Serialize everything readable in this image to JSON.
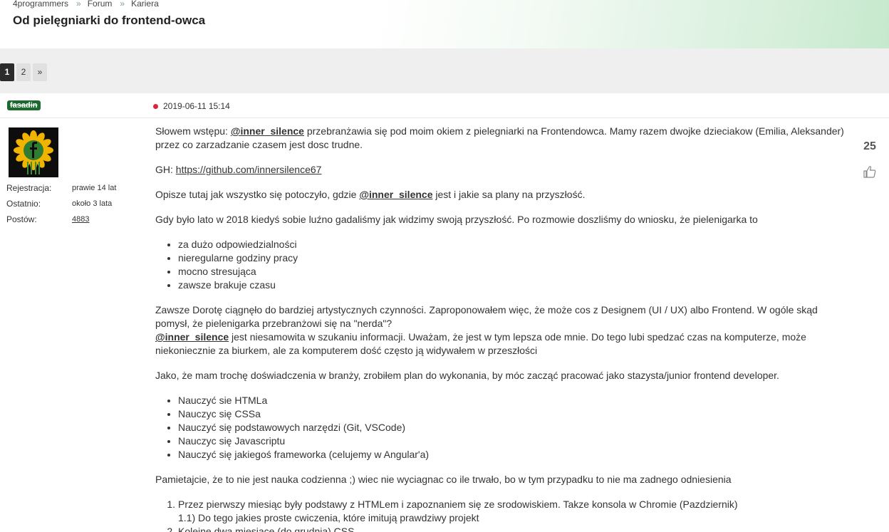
{
  "breadcrumb": {
    "items": [
      "4programmers",
      "Forum",
      "Kariera"
    ],
    "sep": "»"
  },
  "page_title": "Od pielęgniarki do frontend-owca",
  "pager": {
    "pages": [
      "1",
      "2"
    ],
    "next": "»"
  },
  "post": {
    "author": "fasadin",
    "date": "2019-06-11 15:14",
    "votes": "25",
    "user_info": {
      "reg_label": "Rejestracja:",
      "reg_value": "prawie 14 lat",
      "last_label": "Ostatnio:",
      "last_value": "około 3 lata",
      "posts_label": "Postów:",
      "posts_value": "4883"
    },
    "content": {
      "p1_a": "Słowem wstępu: ",
      "mention": "@inner_silence",
      "p1_b": " przebranżawia się pod moim okiem z pielegniarki na Frontendowca. Mamy razem dwojke dzieciakow (Emilia, Aleksander) przez co zarzadzanie czasem jest dosc trudne.",
      "gh_label": "GH: ",
      "gh_link": "https://github.com/innersilence67",
      "p3_a": "Opisze tutaj jak wszystko się potoczyło, gdzie ",
      "p3_b": " jest i jakie sa plany na przyszłość.",
      "p4": "Gdy było lato w 2018 kiedyś sobie luźno gadaliśmy jak widzimy swoją przyszłość. Po rozmowie doszliśmy do wniosku, że pielenigarka to",
      "list1": [
        "za dużo odpowiedzialności",
        "nieregularne godziny pracy",
        "mocno stresująca",
        "zawsze brakuje czasu"
      ],
      "p5_a": "Zawsze Dorotę ciągnęło do bardziej artystycznych czynności. Zaproponowałem więc, że może cos z Designem (UI / UX) albo Frontend. W ogóle skąd pomysł, że pielenigarka przebranżowi się na \"nerda\"?",
      "p5_b": " jest niesamowita w szukaniu informacji. Uważam, że jest w tym lepsza ode mnie. Do tego lubi spedzać czas na komputerze, może niekoniecznie za biurkem, ale za komputerem dość często ją widywałem w przeszłości",
      "p6": "Jako, że mam trochę doświadczenia w branży, zrobiłem plan do wykonania, by móc zacząć pracować jako stazysta/junior frontend developer.",
      "list2": [
        "Nauczyć sie HTMLa",
        "Nauczyc się CSSa",
        "Nauczyć się podstawowych narzędzi (Git, VSCode)",
        "Nauczyc się Javascriptu",
        "Nauczyć się jakiegoś frameworka (celujemy w Angular'a)"
      ],
      "p7": "Pamietajcie, że to nie jest nauka codzienna ;) wiec nie wyciagnac co ile trwało, bo w tym przypadku to nie ma zadnego odniesienia",
      "ol1_a": "Przez pierwszy miesiąc były podstawy z HTMLem i zapoznaniem się ze srodowiskiem. Takze konsola w Chromie (Pazdziernik)",
      "ol1_b": "1.1) Do tego jakies proste cwiczenia, które imitują prawdziwy projekt",
      "ol2": "Kolejne dwa miesiące (do grudnia) CSS"
    }
  },
  "colors": {
    "brand_green": "#1c6b2e",
    "date_dot": "#d7263d"
  }
}
